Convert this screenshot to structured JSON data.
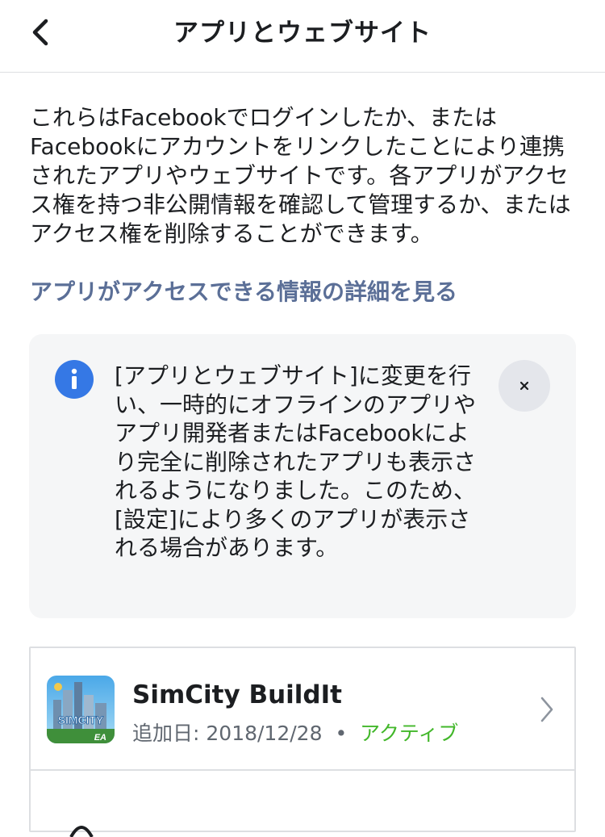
{
  "header": {
    "title": "アプリとウェブサイト",
    "back_icon": "chevron-left-icon"
  },
  "intro": {
    "text": "これらはFacebookでログインしたか、またはFacebookにアカウントをリンクしたことにより連携されたアプリやウェブサイトです。各アプリがアクセス権を持つ非公開情報を確認して管理するか、またはアクセス権を削除することができます。",
    "learn_more": "アプリがアクセスできる情報の詳細を見る"
  },
  "notice": {
    "icon": "info-icon",
    "text": "[アプリとウェブサイト]に変更を行い、一時的にオフラインのアプリやアプリ開発者またはFacebookにより完全に削除されたアプリも表示されるようになりました。このため、[設定]により多くのアプリが表示される場合があります。",
    "dismiss_icon": "close-icon"
  },
  "apps": [
    {
      "name": "SimCity BuildIt",
      "added_label": "追加日:",
      "added_date": "2018/12/28",
      "separator": "•",
      "status": "アクティブ",
      "icon_text": "SIMCITY",
      "icon_badge": "EA"
    }
  ],
  "colors": {
    "link": "#5b6f97",
    "info_blue": "#3578e5",
    "status_active": "#42b72a",
    "notice_bg": "#f5f6f7"
  }
}
